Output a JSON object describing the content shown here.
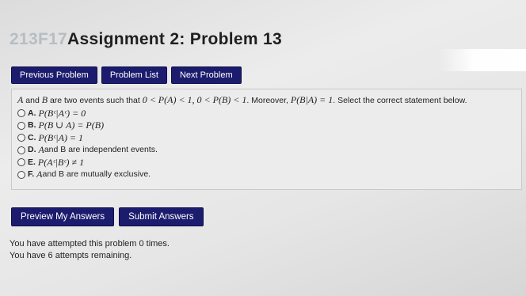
{
  "header": {
    "course": "213F17",
    "title": "Assignment 2: Problem 13"
  },
  "nav": {
    "previous": "Previous Problem",
    "list": "Problem List",
    "next": "Next Problem"
  },
  "problem": {
    "stem": {
      "a": "A",
      "t1": " and ",
      "b": "B",
      "t2": " are two events such that ",
      "m1": "0 < P(A) < 1, 0 < P(B) < 1",
      "t3": ". Moreover, ",
      "m2": "P(B|A) = 1",
      "t4": ". Select the correct statement below."
    },
    "options": [
      {
        "label": "A.",
        "math": "P(Bᶜ|Aᶜ) = 0",
        "text": ""
      },
      {
        "label": "B.",
        "math": "P(B ∪ A) = P(B)",
        "text": ""
      },
      {
        "label": "C.",
        "math": "P(Bᶜ|A) = 1",
        "text": ""
      },
      {
        "label": "D.",
        "math": "A",
        "text": " and B are independent events."
      },
      {
        "label": "E.",
        "math": "P(Aᶜ|Bᶜ) ≠ 1",
        "text": ""
      },
      {
        "label": "F.",
        "math": "A",
        "text": " and B are mutually exclusive."
      }
    ]
  },
  "actions": {
    "preview": "Preview My Answers",
    "submit": "Submit Answers"
  },
  "status": {
    "attempted": "You have attempted this problem 0 times.",
    "remaining": "You have 6 attempts remaining."
  },
  "colors": {
    "button_bg": "#1c1c6e",
    "button_text": "#ffffff",
    "course_text": "#b7bdc3"
  }
}
